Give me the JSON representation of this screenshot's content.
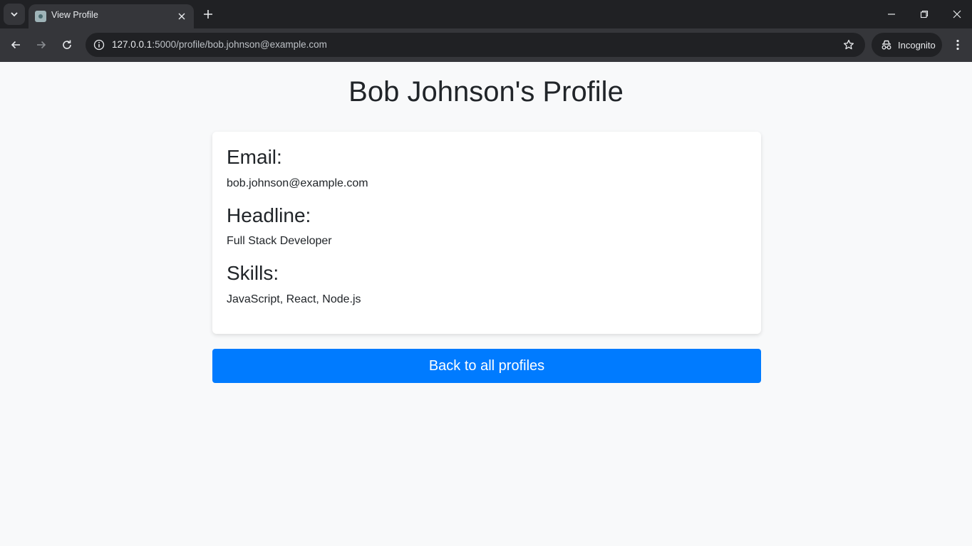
{
  "browser": {
    "tab": {
      "title": "View Profile"
    },
    "address": {
      "host": "127.0.0.1",
      "path": ":5000/profile/bob.johnson@example.com"
    },
    "incognito_label": "Incognito",
    "icons": {
      "tab_search": "chevron-down-icon",
      "tab_close": "close-icon",
      "new_tab": "plus-icon",
      "back": "arrow-left-icon",
      "forward": "arrow-right-icon",
      "reload": "reload-icon",
      "site_info": "info-icon",
      "bookmark": "star-icon",
      "incognito": "incognito-icon",
      "menu": "kebab-menu-icon",
      "minimize": "minimize-icon",
      "restore": "restore-icon",
      "close_window": "close-icon"
    }
  },
  "page": {
    "title": "Bob Johnson's Profile",
    "fields": [
      {
        "label": "Email:",
        "value": "bob.johnson@example.com"
      },
      {
        "label": "Headline:",
        "value": "Full Stack Developer"
      },
      {
        "label": "Skills:",
        "value": "JavaScript, React, Node.js"
      }
    ],
    "back_button_label": "Back to all profiles"
  },
  "colors": {
    "primary_button": "#007bff",
    "page_background": "#f8f9fa",
    "card_background": "#ffffff",
    "text": "#212529"
  }
}
